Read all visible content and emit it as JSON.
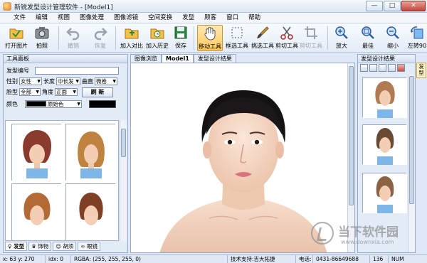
{
  "window": {
    "title": "新锐发型设计管理软件 - [Model1]",
    "minimize": "—",
    "maximize": "□",
    "close": "✕"
  },
  "menu": [
    "文件",
    "编辑",
    "视图",
    "图像处理",
    "图像滤镜",
    "空间变换",
    "发型",
    "顾客",
    "窗口",
    "帮助"
  ],
  "toolbar": {
    "open": "打开图片",
    "photo": "拍照",
    "undo": "撤销",
    "redo": "恢复",
    "compare": "加入对比",
    "history": "加入历史",
    "save": "保存",
    "move": "移动工具",
    "select": "框选工具",
    "pick": "挑选工具",
    "cut": "剪切工具",
    "crop": "剪切工具",
    "zoom_in": "放大",
    "zoom_fit": "最佳",
    "zoom_out": "缩小",
    "rotate_left": "左转90"
  },
  "tool_panel": {
    "title": "工具面板",
    "style_no_label": "发型编号",
    "gender_label": "性别",
    "gender_value": "女性",
    "length_label": "长度",
    "length_value": "中长发",
    "curl_label": "曲直",
    "curl_value": "微卷",
    "face_label": "脸型",
    "face_value": "全部",
    "angle_label": "角度",
    "angle_value": "正面",
    "refresh_button": "刷 新",
    "color_label": "颜色",
    "color_value": "原始色",
    "tabs": [
      "发型",
      "饰物",
      "胡须",
      "眼镜"
    ]
  },
  "document": {
    "tabs": [
      "图像浏览",
      "Model1",
      "发型设计结果"
    ]
  },
  "results_panel": {
    "title": "发型设计结果",
    "side_tab": "发型"
  },
  "status": {
    "coords": "x: 63 y: 270",
    "idx": "idx: 0",
    "rgba": "RGBA: (255, 255, 255, 0)",
    "support": "技术支持:吉大拓捷",
    "phone_label": "电话:",
    "phone": "0431-86649688",
    "phone2": "136",
    "num": "NUM"
  },
  "watermark": {
    "text": "当下软件园",
    "url": "www.downxia.com"
  },
  "colors": {
    "accent": "#ffc75a",
    "panel": "#e3ebf6",
    "border": "#98acc9"
  }
}
